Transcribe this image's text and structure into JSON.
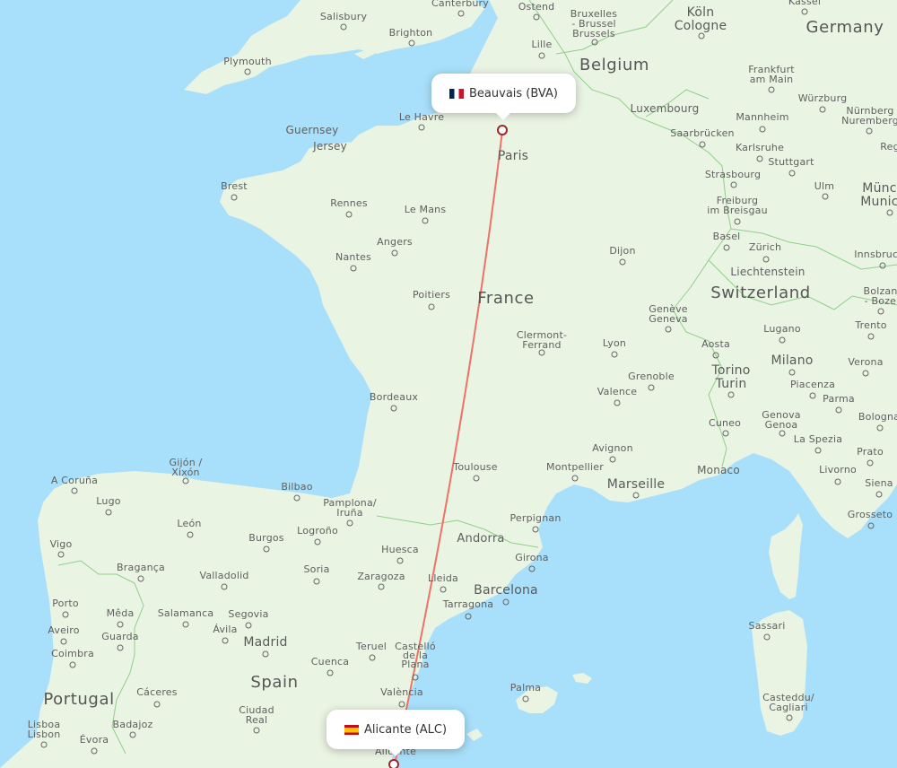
{
  "route": {
    "origin": {
      "name": "Beauvais (BVA)",
      "country_flag": "france-flag",
      "city": "Beauvais",
      "code": "BVA"
    },
    "destination": {
      "name": "Alicante (ALC)",
      "country_flag": "spain-flag",
      "city": "Alicante",
      "code": "ALC"
    },
    "line_color": "#f07167",
    "marker_color": "#a3232b"
  },
  "colors": {
    "water": "#a8dffa",
    "land": "#eaf4e3",
    "border": "#8fcf8a",
    "label": "#5f5f5f"
  },
  "labels": {
    "countries": [
      "Germany",
      "Belgium",
      "France",
      "Switzerland",
      "Spain",
      "Portugal",
      "Andorra",
      "Luxembourg",
      "Liechtenstein",
      "Monaco"
    ],
    "cities": [
      "Salisbury",
      "Canterbury",
      "Ostend",
      "Bruxelles - Brussel Brussels",
      "Köln Cologne",
      "Kassel",
      "Brighton",
      "Lille",
      "Plymouth",
      "Frankfurt am Main",
      "Le Havre",
      "Würzburg",
      "Mannheim",
      "Nürnberg Nuremberg",
      "Guernsey",
      "Jersey",
      "Saarbrücken",
      "Karlsruhe",
      "Paris",
      "Stuttgart",
      "Regensburg",
      "Brest",
      "Strasbourg",
      "Ulm",
      "München Munich",
      "Rennes",
      "Freiburg im Breisgau",
      "Le Mans",
      "Basel",
      "Zürich",
      "Angers",
      "Dijon",
      "Innsbruck",
      "Nantes",
      "Poitiers",
      "Genève Geneva",
      "Bolzano - Bozen",
      "Clermont-Ferrand",
      "Lugano",
      "Trento",
      "Lyon",
      "Aosta",
      "Milano",
      "Verona",
      "Torino Turin",
      "Grenoble",
      "Piacenza",
      "Parma",
      "Bordeaux",
      "Valence",
      "Cuneo",
      "Genova Genoa",
      "Bologna",
      "La Spezia",
      "Avignon",
      "Prato",
      "Gijón / Xixón",
      "Toulouse",
      "Montpellier",
      "Livorno",
      "A Coruña",
      "Marseille",
      "Siena",
      "Bilbao",
      "Pamplona/ Iruña",
      "Lugo",
      "Perpignan",
      "Grosseto",
      "León",
      "Logroño",
      "Burgos",
      "Vigo",
      "Huesca",
      "Girona",
      "Bragança",
      "Soria",
      "Zaragoza",
      "Lleida",
      "Valladolid",
      "Barcelona",
      "Tarragona",
      "Porto",
      "Mêda",
      "Salamanca",
      "Segovia",
      "Sassari",
      "Aveiro",
      "Ávila",
      "Guarda",
      "Madrid",
      "Coimbra",
      "Teruel",
      "Castelló de la Plana",
      "Cuenca",
      "València",
      "Palma",
      "Cáceres",
      "Casteddu/ Cagliari",
      "Lisboa Lisbon",
      "Ciudad Real",
      "Badajoz",
      "Évora",
      "Alicante"
    ]
  },
  "map_labels": {
    "germany": "Germany",
    "belgium": "Belgium",
    "france": "France",
    "switzerland": "Switzerland",
    "spain": "Spain",
    "portugal": "Portugal",
    "andorra": "Andorra",
    "luxembourg": "Luxembourg",
    "liechtenstein": "Liechtenstein",
    "monaco": "Monaco",
    "salisbury": "Salisbury",
    "canterbury": "Canterbury",
    "ostend": "Ostend",
    "brussels": "Bruxelles\n- Brussel\nBrussels",
    "cologne": "Köln\nCologne",
    "kassel": "Kassel",
    "brighton": "Brighton",
    "lille": "Lille",
    "plymouth": "Plymouth",
    "frankfurt": "Frankfurt\nam Main",
    "lehavre": "Le Havre",
    "wurzburg": "Würzburg",
    "mannheim": "Mannheim",
    "nurnberg": "Nürnberg\nNuremberg",
    "guernsey": "Guernsey",
    "jersey": "Jersey",
    "saarbrucken": "Saarbrücken",
    "karlsruhe": "Karlsruhe",
    "paris": "Paris",
    "stuttgart": "Stuttgart",
    "regensburg": "Reg",
    "brest": "Brest",
    "strasbourg": "Strasbourg",
    "ulm": "Ulm",
    "munich": "Münch\nMunich",
    "rennes": "Rennes",
    "freiburg": "Freiburg\nim Breisgau",
    "lemans": "Le Mans",
    "basel": "Basel",
    "zurich": "Zürich",
    "angers": "Angers",
    "dijon": "Dijon",
    "innsbruck": "Innsbruck",
    "nantes": "Nantes",
    "poitiers": "Poitiers",
    "geneva": "Genève\nGeneva",
    "bolzano": "Bolzano\n- Bozen",
    "clermont": "Clermont-\nFerrand",
    "lugano": "Lugano",
    "trento": "Trento",
    "lyon": "Lyon",
    "aosta": "Aosta",
    "milano": "Milano",
    "verona": "Verona",
    "torino": "Torino\nTurin",
    "grenoble": "Grenoble",
    "piacenza": "Piacenza",
    "parma": "Parma",
    "bordeaux": "Bordeaux",
    "valence": "Valence",
    "cuneo": "Cuneo",
    "genova": "Genova\nGenoa",
    "bologna": "Bologna",
    "laspezia": "La Spezia",
    "avignon": "Avignon",
    "prato": "Prato",
    "gijon": "Gijón /\nXixón",
    "toulouse": "Toulouse",
    "montpellier": "Montpellier",
    "livorno": "Livorno",
    "acoruna": "A Coruña",
    "marseille": "Marseille",
    "siena": "Siena",
    "bilbao": "Bilbao",
    "pamplona": "Pamplona/\nIruña",
    "lugo": "Lugo",
    "perpignan": "Perpignan",
    "grosseto": "Grosseto",
    "leon": "León",
    "logrono": "Logroño",
    "burgos": "Burgos",
    "vigo": "Vigo",
    "huesca": "Huesca",
    "girona": "Girona",
    "braganca": "Bragança",
    "soria": "Soria",
    "zaragoza": "Zaragoza",
    "lleida": "Lleida",
    "valladolid": "Valladolid",
    "barcelona": "Barcelona",
    "tarragona": "Tarragona",
    "porto": "Porto",
    "meda": "Mêda",
    "salamanca": "Salamanca",
    "segovia": "Segovia",
    "sassari": "Sassari",
    "aveiro": "Aveiro",
    "avila": "Ávila",
    "guarda": "Guarda",
    "madrid": "Madrid",
    "coimbra": "Coimbra",
    "teruel": "Teruel",
    "castello": "Castelló\nde la\nPlana",
    "cuenca": "Cuenca",
    "valencia": "València",
    "palma": "Palma",
    "caceres": "Cáceres",
    "cagliari": "Casteddu/\nCagliari",
    "lisbon": "Lisboa\nLisbon",
    "ciudadreal": "Ciudad\nReal",
    "badajoz": "Badajoz",
    "evora": "Évora",
    "alicante": "Alicante"
  }
}
